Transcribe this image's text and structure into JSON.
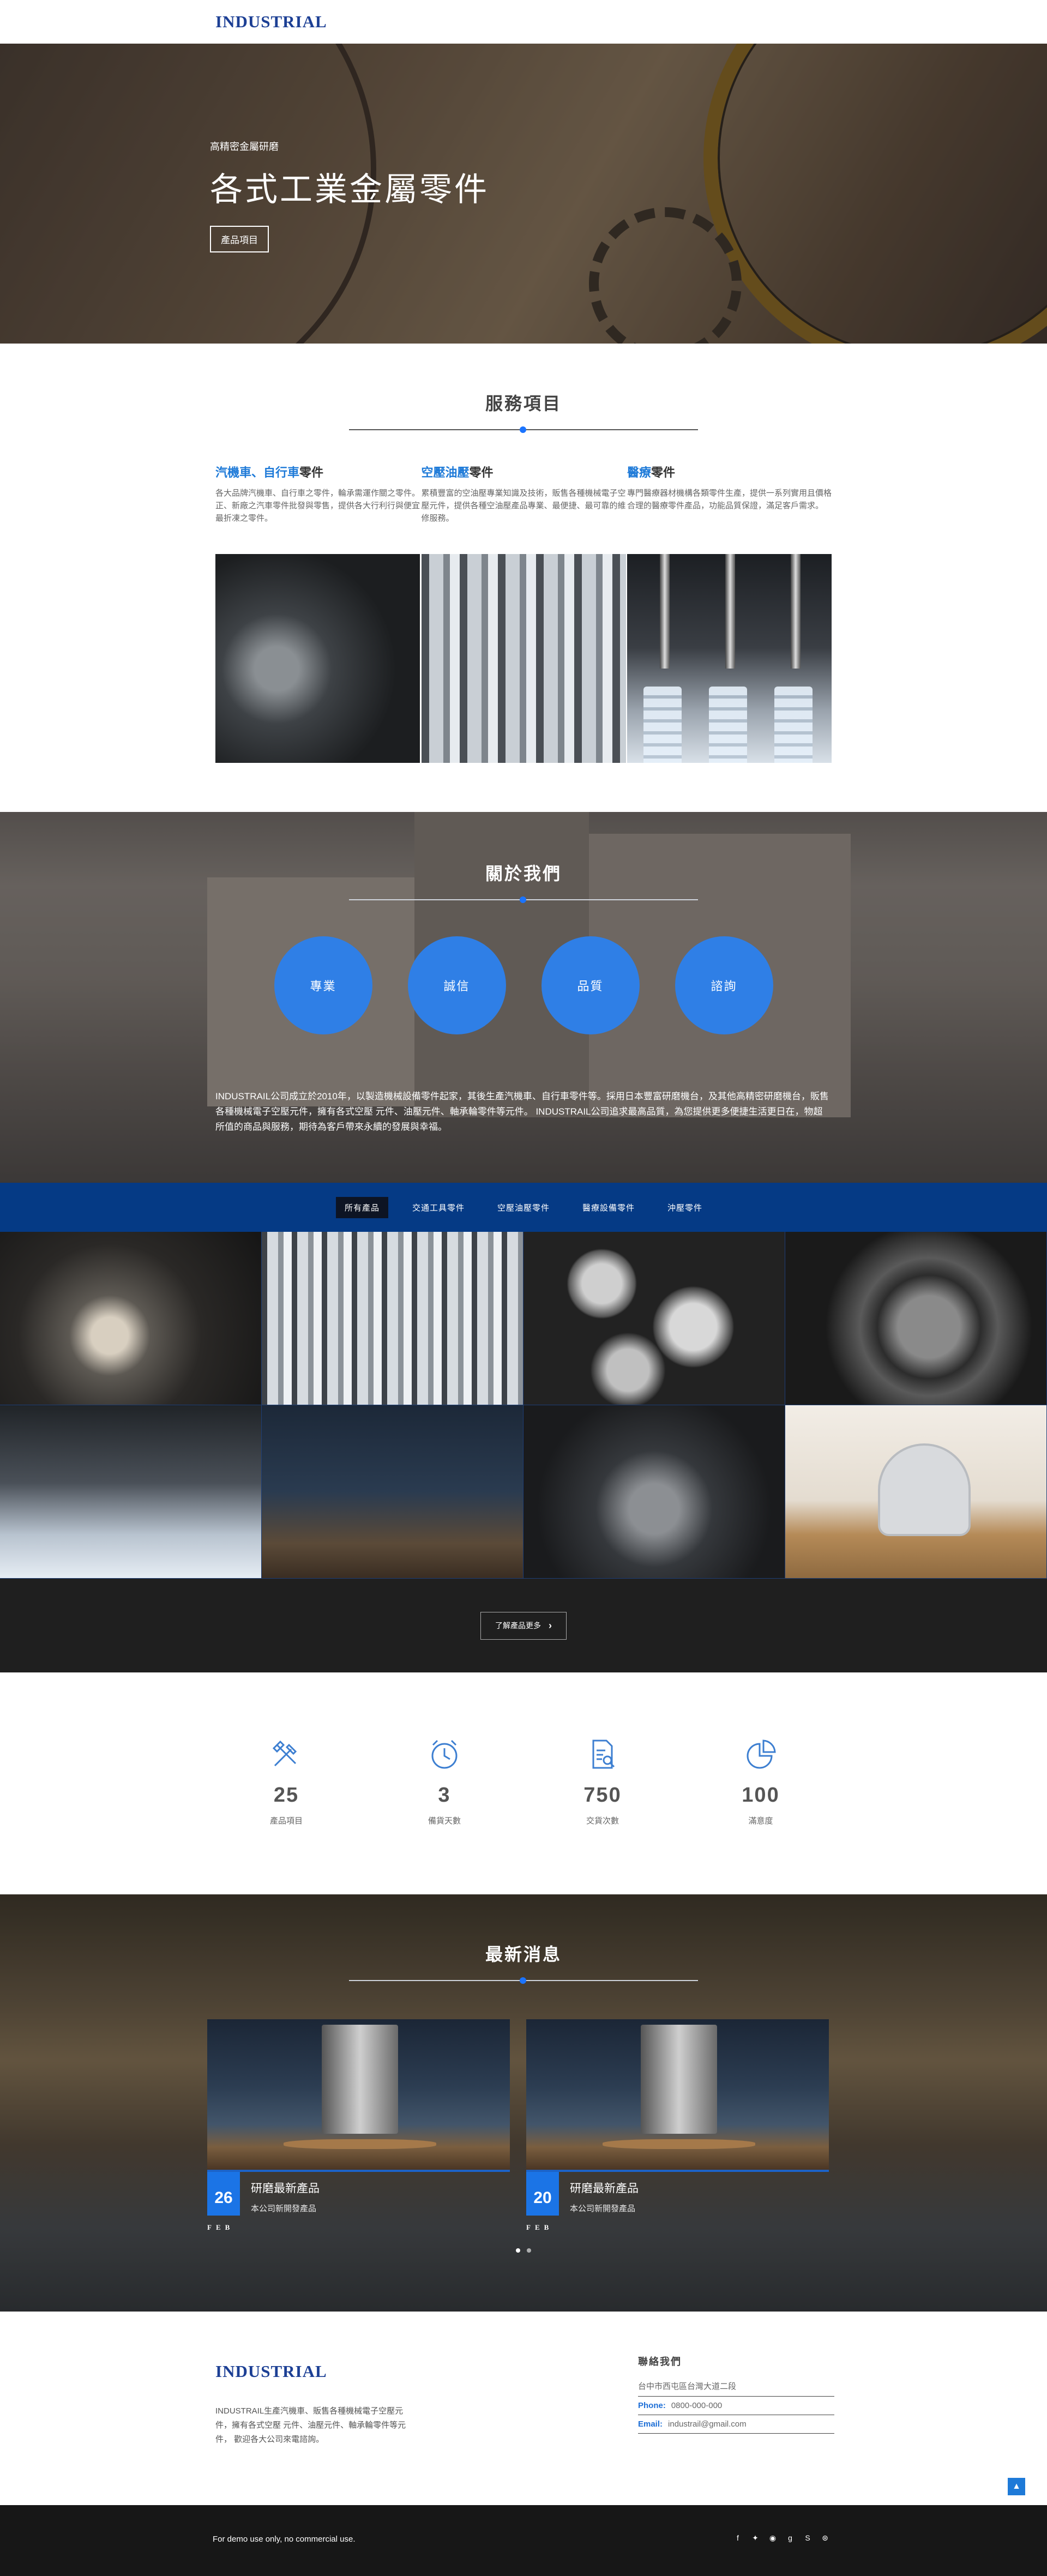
{
  "header": {
    "logo": "INDUSTRIAL"
  },
  "hero": {
    "subtitle": "高精密金屬研磨",
    "title": "各式工業金屬零件",
    "button": "產品項目"
  },
  "services": {
    "title": "服務項目",
    "items": [
      {
        "highlight": "汽機車、自行車",
        "suffix": "零件",
        "desc": "各大品牌汽機車、自行車之零件，輪承需運作關之零件。正、新廠之汽車零件批發與零售，提供各大行利行與便宜最折凍之零件。"
      },
      {
        "highlight": "空壓油壓",
        "suffix": "零件",
        "desc": "累積豐富的空油壓專業知識及技術，販售各種機械電子空壓元件，提供各種空油壓產品專業、最便捷、最可靠的維修服務。"
      },
      {
        "highlight": "醫療",
        "suffix": "零件",
        "desc": "專門醫療器材機構各類零件生產，提供一系列實用且價格合理的醫療零件產品，功能品質保證，滿足客戶需求。"
      }
    ]
  },
  "about": {
    "title": "關於我們",
    "circles": [
      "專業",
      "誠信",
      "品質",
      "諮詢"
    ],
    "desc": "INDUSTRAIL公司成立於2010年，以製造機械設備零件起家，其後生產汽機車、自行車零件等。採用日本豐富研磨機台，及其他高精密研磨機台，販售各種機械電子空壓元件，擁有各式空壓 元件、油壓元件、軸承輪零件等元件。 INDUSTRAIL公司追求最高品質，為您提供更多便捷生活更日在，物超所值的商品與服務，期待為客戶帶來永續的發展與幸福。"
  },
  "portfolio": {
    "filters": [
      "所有產品",
      "交通工具零件",
      "空壓油壓零件",
      "醫療設備零件",
      "沖壓零件"
    ],
    "more_button": "了解產品更多"
  },
  "stats": [
    {
      "icon": "tools-icon",
      "value": "25",
      "label": "產品項目"
    },
    {
      "icon": "clock-icon",
      "value": "3",
      "label": "備貨天數"
    },
    {
      "icon": "document-icon",
      "value": "750",
      "label": "交貨次數"
    },
    {
      "icon": "pie-chart-icon",
      "value": "100",
      "label": "滿意度"
    }
  ],
  "news": {
    "title": "最新消息",
    "items": [
      {
        "day": "26",
        "month": "FEB",
        "title": "研磨最新產品",
        "desc": "本公司新開發產品"
      },
      {
        "day": "20",
        "month": "FEB",
        "title": "研磨最新產品",
        "desc": "本公司新開發產品"
      }
    ]
  },
  "footer": {
    "logo": "INDUSTRIAL",
    "about": "INDUSTRAIL生產汽機車、販售各種機械電子空壓元件，擁有各式空壓 元件、油壓元件、軸承輪零件等元件， 歡迎各大公司來電諮詢。",
    "contact_title": "聯絡我們",
    "address": "台中市西屯區台灣大道二段",
    "phone_label": "Phone:",
    "phone": "0800-000-000",
    "email_label": "Email:",
    "email": "industrail@gmail.com",
    "copyright": "For demo use only, no commercial use.",
    "socials": [
      "facebook-icon",
      "twitter-icon",
      "rss-icon",
      "google-plus-icon",
      "skype-icon",
      "dribbble-icon"
    ]
  },
  "colors": {
    "brand": "#1c3f94",
    "accent": "#1b74e6",
    "filter_bar": "#053a85"
  }
}
